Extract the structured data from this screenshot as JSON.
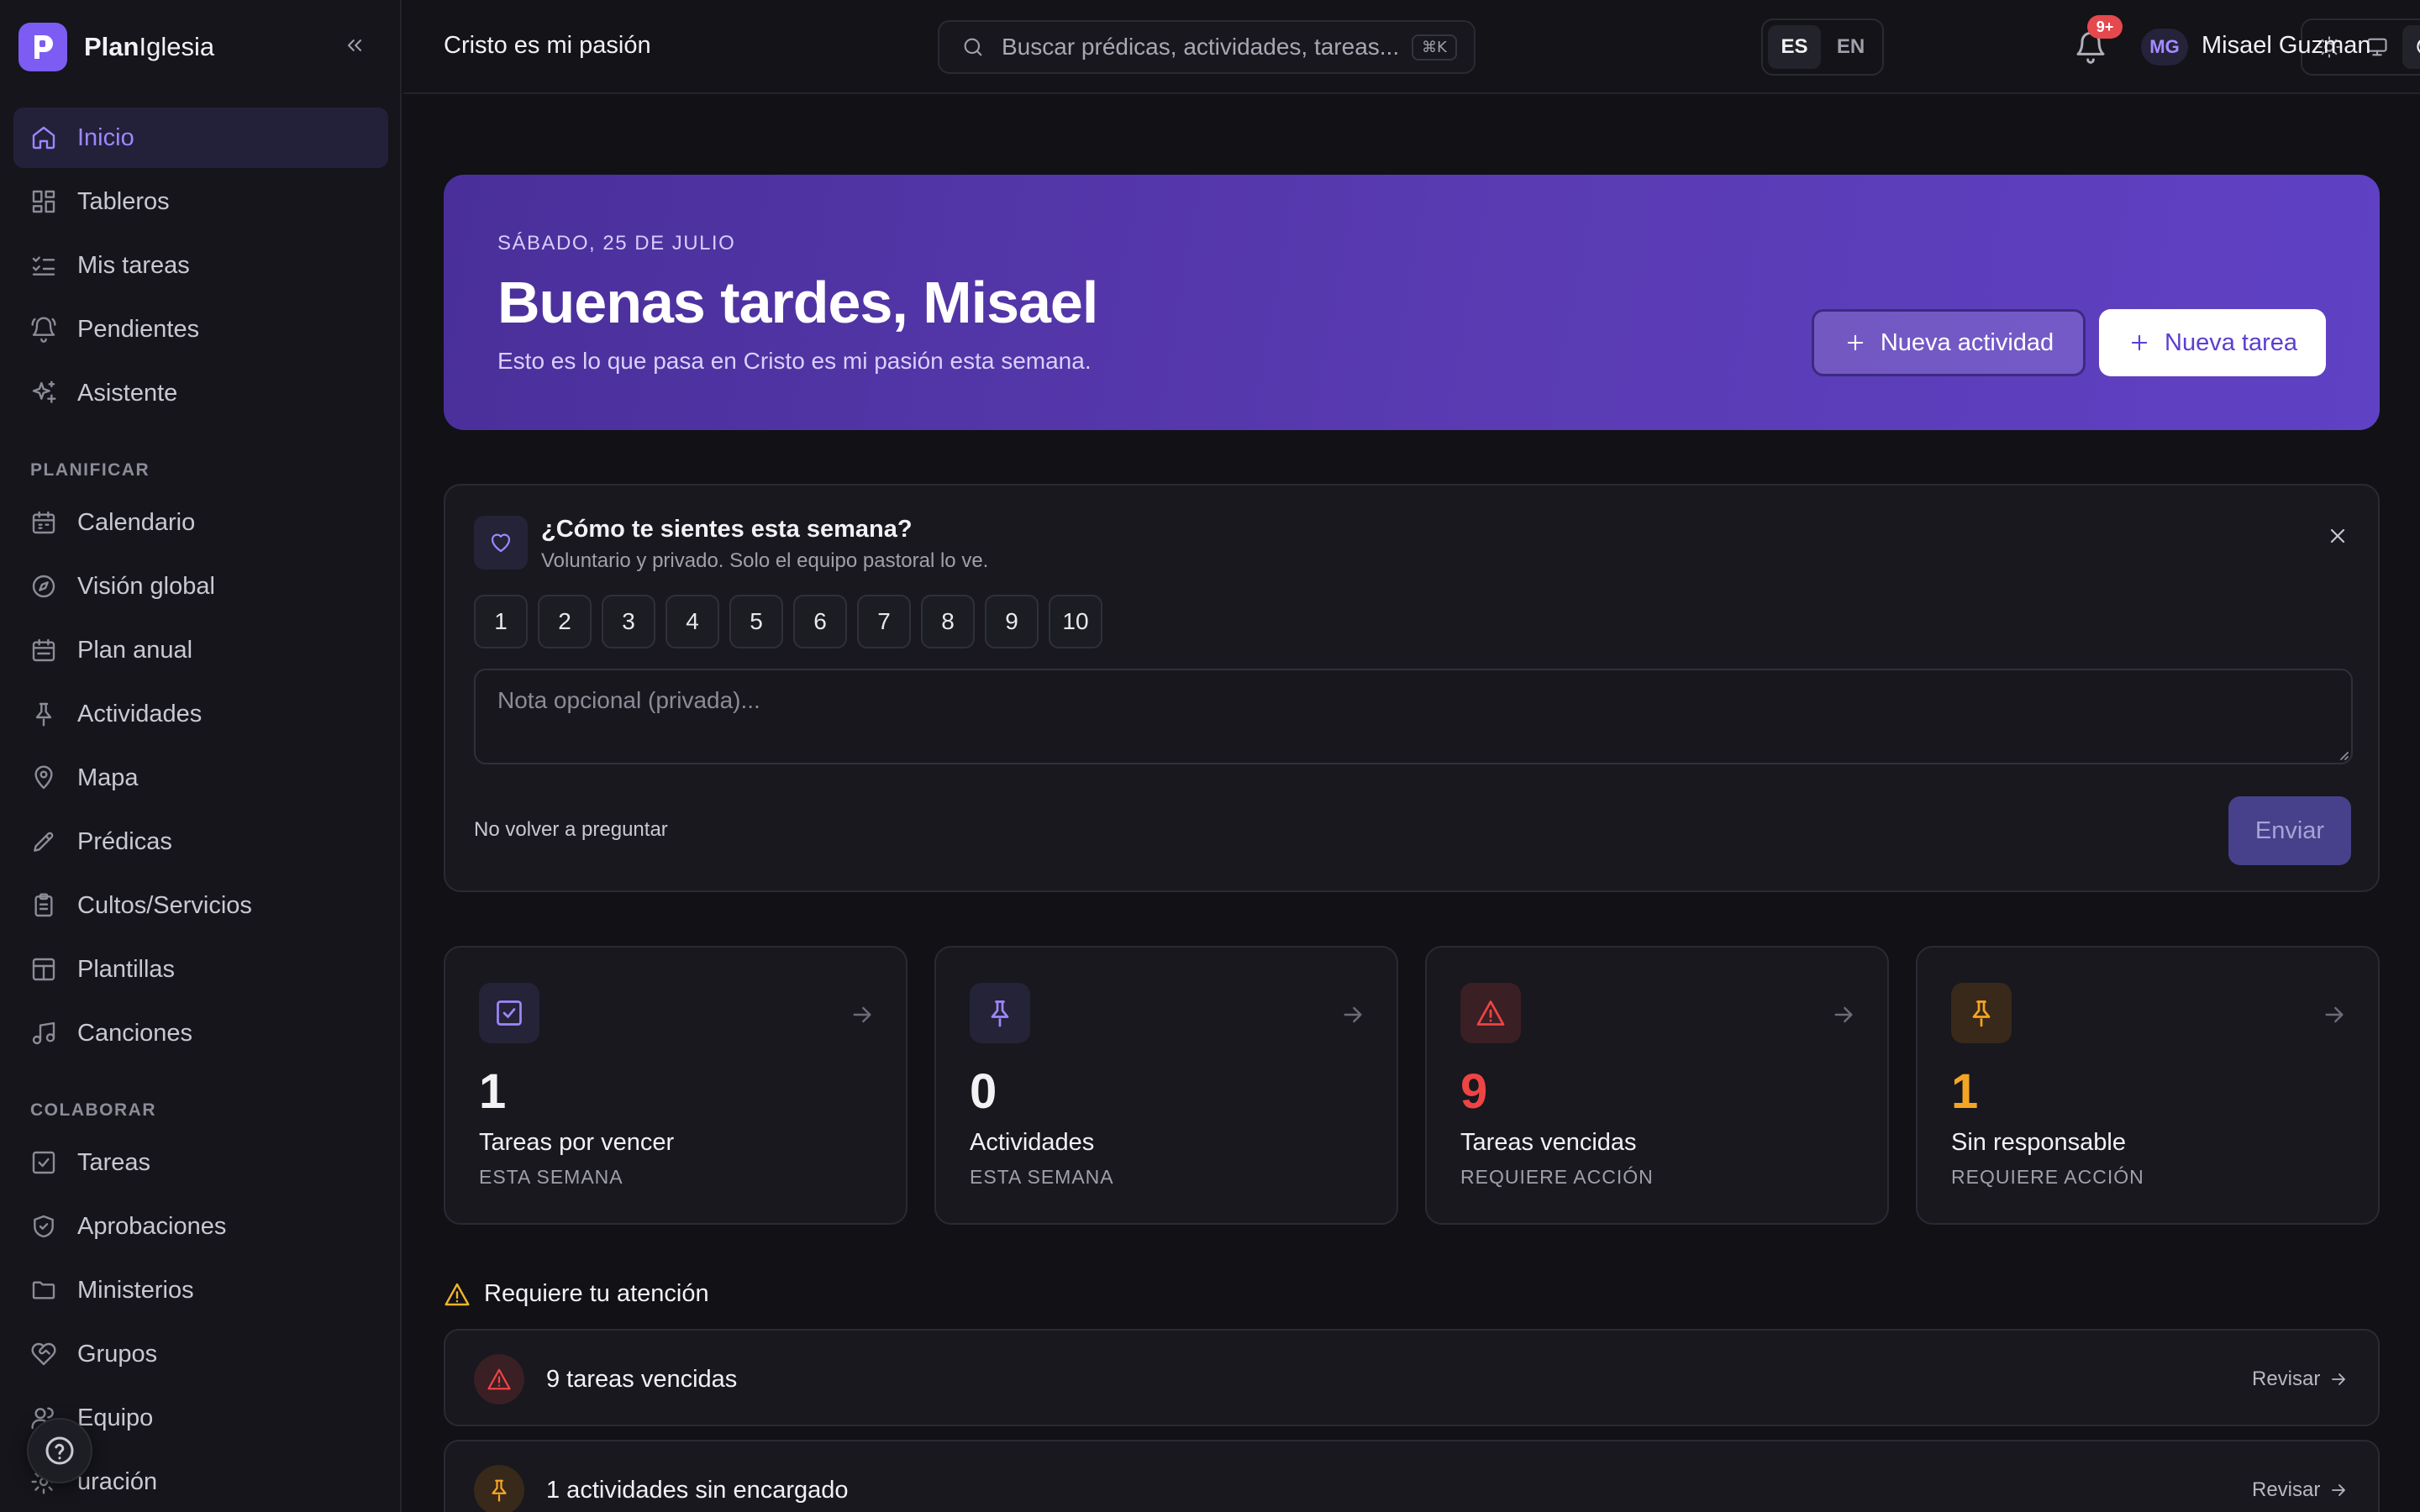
{
  "brand": {
    "name_bold": "Plan",
    "name_rest": "Iglesia"
  },
  "sidebar": {
    "items_main": [
      {
        "label": "Inicio",
        "icon": "home-icon",
        "active": true
      },
      {
        "label": "Tableros",
        "icon": "grid-icon"
      },
      {
        "label": "Mis tareas",
        "icon": "list-check-icon"
      },
      {
        "label": "Pendientes",
        "icon": "bell-ring-icon"
      },
      {
        "label": "Asistente",
        "icon": "sparkles-icon"
      }
    ],
    "section_plan": "PLANIFICAR",
    "items_plan": [
      {
        "label": "Calendario",
        "icon": "calendar-icon"
      },
      {
        "label": "Visión global",
        "icon": "compass-icon"
      },
      {
        "label": "Plan anual",
        "icon": "calendar-range-icon"
      },
      {
        "label": "Actividades",
        "icon": "pin-icon"
      },
      {
        "label": "Mapa",
        "icon": "map-pin-icon"
      },
      {
        "label": "Prédicas",
        "icon": "pen-icon"
      },
      {
        "label": "Cultos/Servicios",
        "icon": "clipboard-icon"
      },
      {
        "label": "Plantillas",
        "icon": "layout-icon"
      },
      {
        "label": "Canciones",
        "icon": "music-icon"
      }
    ],
    "section_collab": "COLABORAR",
    "items_collab": [
      {
        "label": "Tareas",
        "icon": "square-check-icon"
      },
      {
        "label": "Aprobaciones",
        "icon": "shield-check-icon"
      },
      {
        "label": "Ministerios",
        "icon": "folder-icon"
      },
      {
        "label": "Grupos",
        "icon": "heart-handshake-icon"
      },
      {
        "label": "Equipo",
        "icon": "users-icon"
      },
      {
        "label": "uración",
        "icon": "settings-icon"
      }
    ]
  },
  "topbar": {
    "org_name": "Cristo es mi pasión",
    "search_placeholder": "Buscar prédicas, actividades, tareas...",
    "search_shortcut": "⌘K",
    "lang_es": "ES",
    "lang_en": "EN",
    "notif_count": "9+",
    "avatar_initials": "MG",
    "user_name": "Misael Guzman"
  },
  "hero": {
    "date": "SÁBADO, 25 DE JULIO",
    "greeting": "Buenas tardes, Misael",
    "subtitle": "Esto es lo que pasa en Cristo es mi pasión esta semana.",
    "btn_activity": "Nueva actividad",
    "btn_task": "Nueva tarea"
  },
  "mood": {
    "title": "¿Cómo te sientes esta semana?",
    "subtitle": "Voluntario y privado. Solo el equipo pastoral lo ve.",
    "scale": [
      "1",
      "2",
      "3",
      "4",
      "5",
      "6",
      "7",
      "8",
      "9",
      "10"
    ],
    "note_placeholder": "Nota opcional (privada)...",
    "no_ask": "No volver a preguntar",
    "send": "Enviar"
  },
  "stats": [
    {
      "value": "1",
      "label": "Tareas por vencer",
      "sub": "ESTA SEMANA",
      "icon": "square-check-icon",
      "color": "#9e86ff",
      "bg": "#252338"
    },
    {
      "value": "0",
      "label": "Actividades",
      "sub": "ESTA SEMANA",
      "icon": "pin-icon",
      "color": "#9e86ff",
      "bg": "#252338"
    },
    {
      "value": "9",
      "label": "Tareas vencidas",
      "sub": "REQUIERE ACCIÓN",
      "icon": "alert-triangle-icon",
      "color": "#ef4444",
      "bg": "#3a1f24"
    },
    {
      "value": "1",
      "label": "Sin responsable",
      "sub": "REQUIERE ACCIÓN",
      "icon": "pin-icon",
      "color": "#f5a524",
      "bg": "#38291a"
    }
  ],
  "attention": {
    "title": "Requiere tu atención",
    "rows": [
      {
        "text": "9 tareas vencidas",
        "link": "Revisar",
        "icon": "alert-triangle-icon",
        "color": "#ef4444",
        "bg": "#3a1f24"
      },
      {
        "text": "1 actividades sin encargado",
        "link": "Revisar",
        "icon": "pin-icon",
        "color": "#f5a524",
        "bg": "#38291a"
      }
    ]
  }
}
